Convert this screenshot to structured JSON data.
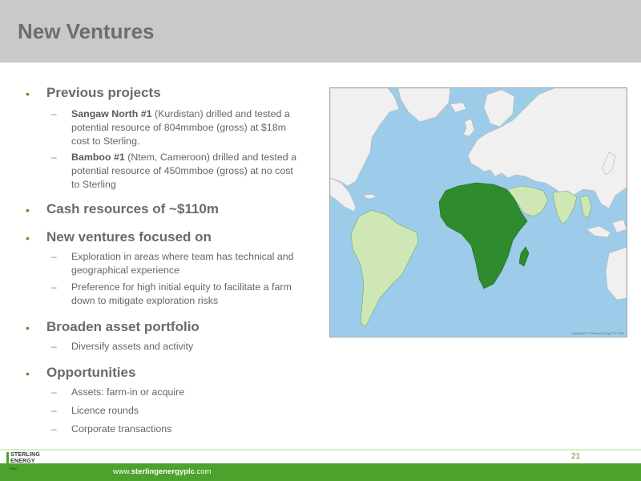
{
  "header": {
    "title": "New Ventures"
  },
  "sections": [
    {
      "heading": "Previous projects",
      "items": [
        {
          "bold": "Sangaw North #1",
          "rest": " (Kurdistan) drilled and tested a potential resource of 804mmboe (gross) at $18m cost to Sterling."
        },
        {
          "bold": "Bamboo #1",
          "rest": " (Ntem, Cameroon) drilled and tested a potential resource of 450mmboe (gross) at no cost to Sterling"
        }
      ]
    },
    {
      "heading": "Cash resources of ~$110m",
      "items": []
    },
    {
      "heading": "New ventures focused on",
      "items": [
        {
          "text": "Exploration in areas where team has technical and geographical experience"
        },
        {
          "text": "Preference for high initial equity to facilitate a farm down to mitigate exploration risks"
        }
      ]
    },
    {
      "heading": "Broaden asset portfolio",
      "items": [
        {
          "text": "Diversify assets and activity"
        }
      ]
    },
    {
      "heading": "Opportunities",
      "items": [
        {
          "text": "Assets: farm-in or acquire"
        },
        {
          "text": "Licence rounds"
        },
        {
          "text": "Corporate transactions"
        }
      ]
    }
  ],
  "bullet_glyph": "•",
  "dash_glyph": "–",
  "map": {
    "copyright": "Copyright © Sterling Energy Plc 2010",
    "colors": {
      "ocean": "#9ccce9",
      "land": "#f0f0f0",
      "highlight_dark": "#2e8b2e",
      "highlight_light": "#cfe7b5"
    }
  },
  "footer": {
    "page_number": "21",
    "url_prefix": "www.",
    "url_bold": "sterlingenergyplc",
    "url_suffix": ".com",
    "logo_line1": "STERLING",
    "logo_line2": "ENERGY",
    "logo_line3": "PLC"
  }
}
